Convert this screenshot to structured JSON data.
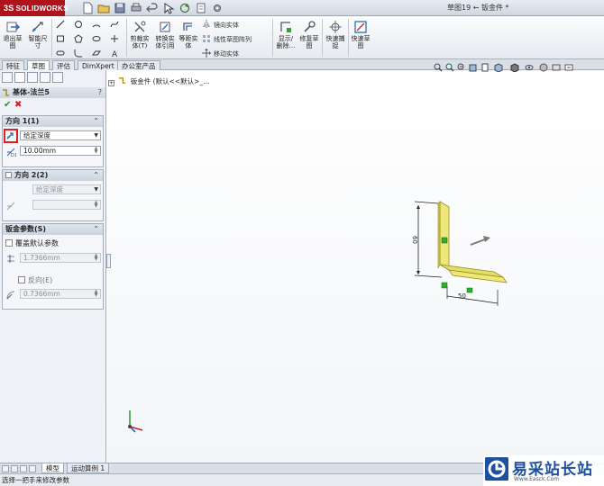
{
  "app": {
    "logo": "SOLIDWORKS",
    "logo_prefix": "3S",
    "document_title": "草图19 ← 钣金件 *"
  },
  "ribbon": {
    "exit_sketch": "退出草\n图",
    "smart_dimension": "智能尺\n寸",
    "trim_entities": "剪裁实\n体(T)",
    "convert_entities": "转换实\n体引用",
    "offset_entities": "等距实\n体",
    "mirror_entities": "镜向实体",
    "linear_pattern": "线性草图阵列",
    "move_entities": "移动实体",
    "display_delete": "显示/\n删除...",
    "repair_sketch": "修复草\n图",
    "quick_snaps": "快速捕\n捉",
    "rapid_sketch": "快速草\n图"
  },
  "tabs": [
    "特征",
    "草图",
    "评估",
    "DimXpert",
    "办公室产品"
  ],
  "active_tab": 1,
  "tree": {
    "root": "钣金件 (默认<<默认>_..."
  },
  "property_manager": {
    "title": "基体-法兰5",
    "help": "?",
    "ok_icon": "check-icon",
    "cancel_icon": "close-icon",
    "direction1": {
      "title": "方向 1(1)",
      "end_condition": "给定深度",
      "depth": "10.00mm"
    },
    "direction2": {
      "title": "方向 2(2)",
      "end_condition": "给定深度",
      "depth": ""
    },
    "sheetmetal": {
      "title": "钣金参数(S)",
      "override_default": "覆盖默认参数",
      "thickness": "1.7366mm",
      "reverse": "反向(E)",
      "bend_radius": "0.7366mm"
    }
  },
  "model": {
    "dim_vertical": "60",
    "dim_horizontal": "50"
  },
  "bottom_tabs": [
    "模型",
    "运动算例 1"
  ],
  "status": "选择一把手来修改参数",
  "watermark": {
    "name": "易采站长站",
    "url": "Www.Easck.Com"
  },
  "colors": {
    "brand": "#b0121b",
    "highlight_red": "#e02020",
    "model_yellow": "#e8e26a",
    "watermark_blue": "#1f4f9f"
  }
}
